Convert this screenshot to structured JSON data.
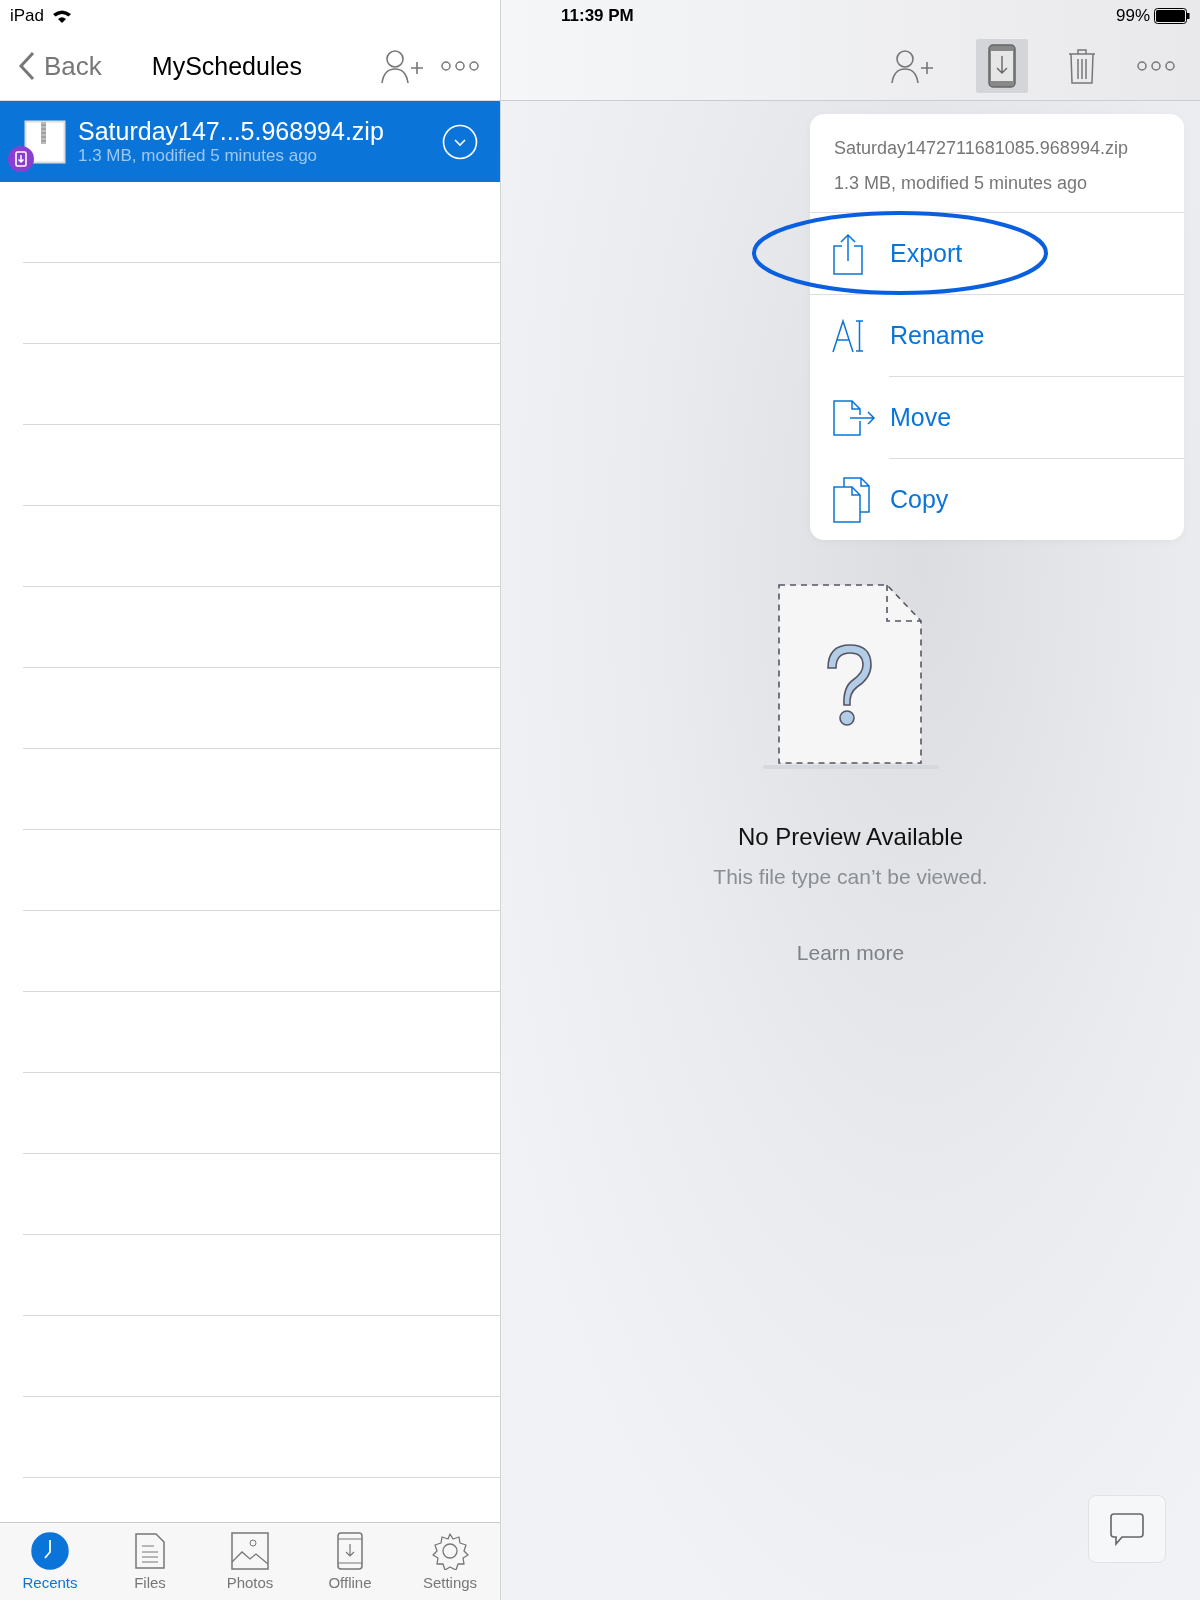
{
  "status_bar": {
    "device": "iPad",
    "time": "11:39 PM",
    "battery": "99%"
  },
  "nav": {
    "back": "Back",
    "title": "MySchedules"
  },
  "files": [
    {
      "name": "Saturday147...5.968994.zip",
      "meta": "1.3 MB, modified 5 minutes ago",
      "selected": true,
      "offline": true
    }
  ],
  "tab_bar": [
    {
      "label": "Recents",
      "kind": "recents",
      "selected": true
    },
    {
      "label": "Files",
      "kind": "files",
      "selected": false
    },
    {
      "label": "Photos",
      "kind": "photos",
      "selected": false
    },
    {
      "label": "Offline",
      "kind": "offline",
      "selected": false
    },
    {
      "label": "Settings",
      "kind": "settings",
      "selected": false
    }
  ],
  "toolbar": {
    "offline_on": true
  },
  "menu": {
    "file_name": "Saturday1472711681085.968994.zip",
    "meta": "1.3 MB, modified 5 minutes ago",
    "items": [
      {
        "label": "Export",
        "kind": "export",
        "circled": true
      },
      {
        "label": "Rename",
        "kind": "rename",
        "circled": false
      },
      {
        "label": "Move",
        "kind": "move",
        "circled": false
      },
      {
        "label": "Copy",
        "kind": "copy",
        "circled": false
      }
    ]
  },
  "preview": {
    "title": "No Preview Available",
    "message": "This file type can’t be viewed.",
    "link": "Learn more"
  }
}
